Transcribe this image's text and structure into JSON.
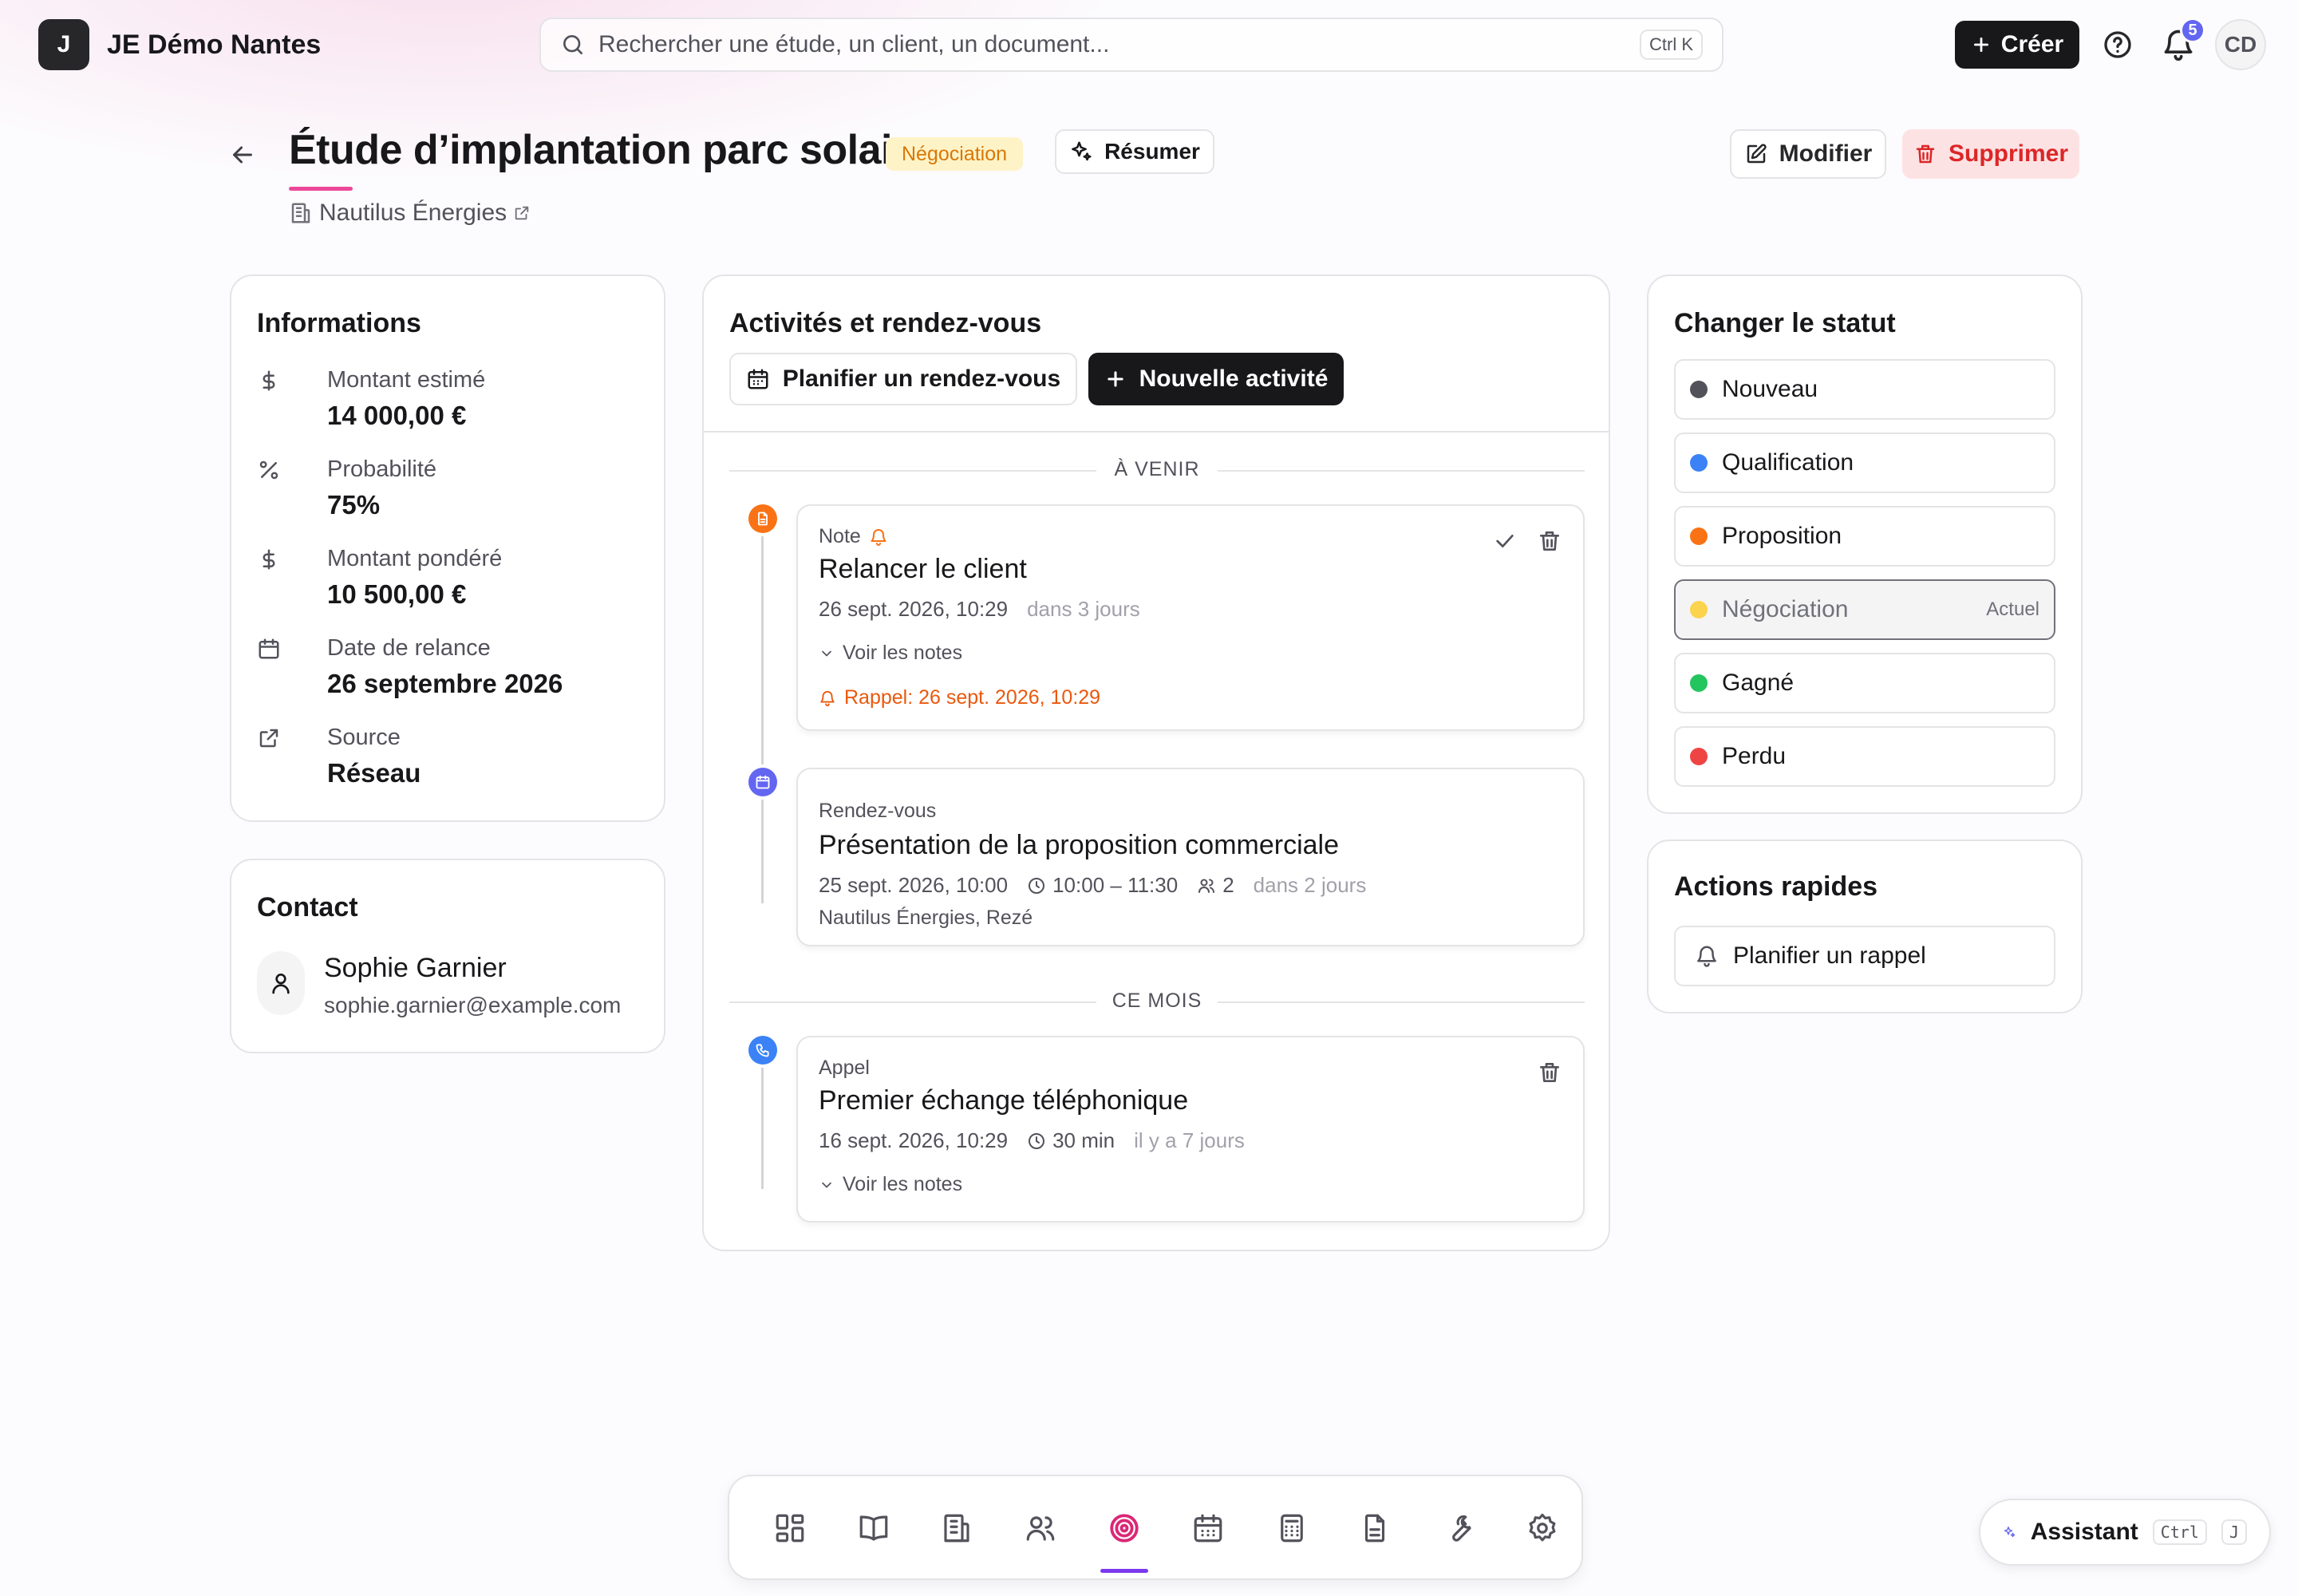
{
  "app": {
    "logo_letter": "J",
    "name": "JE Démo Nantes"
  },
  "topbar": {
    "search_placeholder": "Rechercher une étude, un client, un document...",
    "search_shortcut": "Ctrl K",
    "create_label": "Créer",
    "notification_count": "5",
    "user_initials": "CD"
  },
  "header": {
    "title": "Étude d’implantation parc solaire",
    "status": "Négociation",
    "summarize_label": "Résumer",
    "company": "Nautilus Énergies",
    "edit_label": "Modifier",
    "delete_label": "Supprimer"
  },
  "info": {
    "title": "Informations",
    "rows": [
      {
        "icon": "dollar-icon",
        "label": "Montant estimé",
        "value": "14 000,00 €"
      },
      {
        "icon": "percent-icon",
        "label": "Probabilité",
        "value": "75%"
      },
      {
        "icon": "dollar-icon",
        "label": "Montant pondéré",
        "value": "10 500,00 €"
      },
      {
        "icon": "calendar-icon",
        "label": "Date de relance",
        "value": "26 septembre 2026"
      },
      {
        "icon": "external-link-icon",
        "label": "Source",
        "value": "Réseau"
      }
    ]
  },
  "contact": {
    "title": "Contact",
    "name": "Sophie Garnier",
    "email": "sophie.garnier@example.com"
  },
  "activities": {
    "title": "Activités et rendez-vous",
    "plan_label": "Planifier un rendez-vous",
    "new_label": "Nouvelle activité",
    "group_upcoming": "À VENIR",
    "group_month": "CE MOIS",
    "items": [
      {
        "type": "Note",
        "title": "Relancer le client",
        "date": "26 sept. 2026, 10:29",
        "relative": "dans 3 jours",
        "notes_toggle": "Voir les notes",
        "reminder": "Rappel: 26 sept. 2026, 10:29"
      },
      {
        "type": "Rendez-vous",
        "title": "Présentation de la proposition commerciale",
        "date": "25 sept. 2026, 10:00",
        "time_range": "10:00 – 11:30",
        "attendees": "2",
        "relative": "dans 2 jours",
        "location": "Nautilus Énergies, Rezé"
      },
      {
        "type": "Appel",
        "title": "Premier échange téléphonique",
        "date": "16 sept. 2026, 10:29",
        "duration": "30 min",
        "relative": "il y a 7 jours",
        "notes_toggle": "Voir les notes"
      }
    ]
  },
  "status_panel": {
    "title": "Changer le statut",
    "current_label": "Actuel",
    "options": [
      {
        "label": "Nouveau",
        "color": "#52525b"
      },
      {
        "label": "Qualification",
        "color": "#3b82f6"
      },
      {
        "label": "Proposition",
        "color": "#f97316"
      },
      {
        "label": "Négociation",
        "color": "#fcd34d"
      },
      {
        "label": "Gagné",
        "color": "#22c55e"
      },
      {
        "label": "Perdu",
        "color": "#ef4444"
      }
    ]
  },
  "quick_actions": {
    "title": "Actions rapides",
    "reminder_label": "Planifier un rappel"
  },
  "dock": {
    "items": [
      "dashboard-icon",
      "book-icon",
      "building-icon",
      "users-icon",
      "target-icon",
      "calendar-icon",
      "calculator-icon",
      "document-icon",
      "wrench-icon",
      "settings-icon"
    ],
    "active": "target-icon"
  },
  "assistant": {
    "label": "Assistant",
    "key1": "Ctrl",
    "key2": "J"
  },
  "colors": {
    "accent": "#ec4899",
    "primary": "#18181b",
    "danger": "#dc2626",
    "note": "#f97316",
    "meeting": "#6366f1",
    "call": "#3b82f6"
  }
}
